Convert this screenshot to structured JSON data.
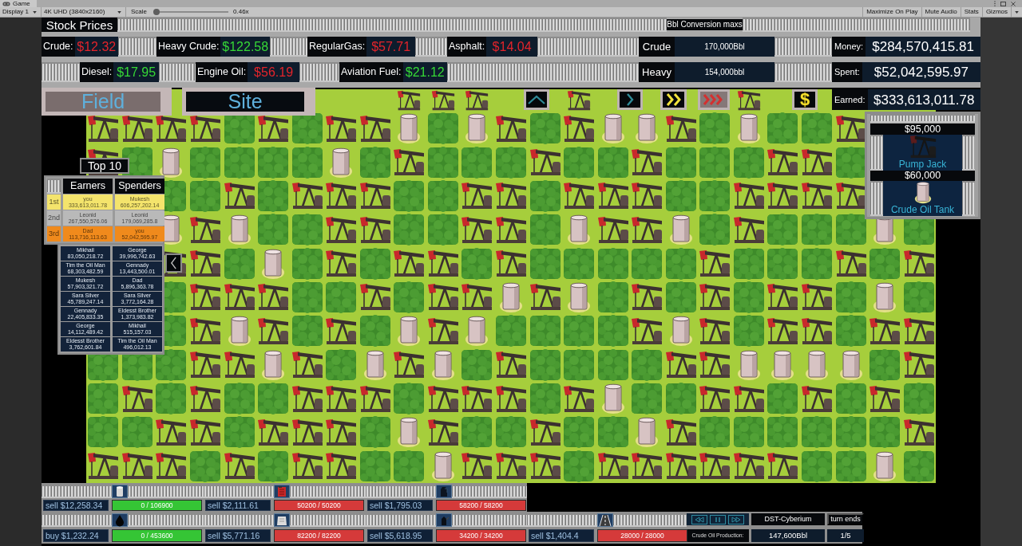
{
  "editor": {
    "tab": "Game",
    "display": "Display 1",
    "resolution": "4K UHD (3840x2160)",
    "scale_label": "Scale",
    "scale": {
      "level": 0
    },
    "scale_value": "0.46x",
    "buttons": [
      "Maximize On Play",
      "Mute Audio",
      "Stats",
      "Gizmos"
    ]
  },
  "stock_prices": {
    "title": "Stock Prices",
    "items": [
      {
        "label": "Crude:",
        "price": "$12.32",
        "rising": false
      },
      {
        "label": "Heavy Crude:",
        "price": "$122.58",
        "rising": true
      },
      {
        "label": "RegularGas:",
        "price": "$57.71",
        "rising": false
      },
      {
        "label": "Asphalt:",
        "price": "$14.04",
        "rising": false
      },
      {
        "label": "Diesel:",
        "price": "$17.95",
        "rising": true
      },
      {
        "label": "Engine Oil:",
        "price": "$56.19",
        "rising": false
      },
      {
        "label": "Aviation Fuel:",
        "price": "$21.12",
        "rising": true
      }
    ]
  },
  "conversion": {
    "title": "Bbl Conversion maxs",
    "items": [
      {
        "label": "Crude",
        "value": "170,000Bbl"
      },
      {
        "label": "Heavy",
        "value": "154,000bbl"
      }
    ]
  },
  "finances": [
    {
      "label": "Money:",
      "value": "$284,570,415.81"
    },
    {
      "label": "Spent:",
      "value": "$52,042,595.97"
    },
    {
      "label": "Earned:",
      "value": "$333,613,011.78"
    }
  ],
  "views": [
    {
      "label": "Field",
      "selected": true
    },
    {
      "label": "Site",
      "selected": false
    }
  ],
  "control_buttons": [
    {
      "kind": "up",
      "selected": false
    },
    {
      "kind": "play",
      "selected": false
    },
    {
      "kind": "fast",
      "selected": false
    },
    {
      "kind": "faster",
      "selected": true
    },
    {
      "kind": "money",
      "label": "$",
      "selected": false
    }
  ],
  "map": {
    "rows": [
      [
        null,
        null,
        null,
        null,
        null,
        null,
        null,
        null,
        null,
        {
          "kind": "jack"
        },
        {
          "kind": "jack"
        },
        {
          "kind": "jack"
        },
        null,
        null,
        {
          "kind": "jack"
        },
        null,
        null,
        null,
        null,
        {
          "kind": "jack"
        },
        null,
        null,
        null,
        null,
        null
      ],
      [
        {
          "kind": "jack"
        },
        {
          "kind": "jack"
        },
        {
          "kind": "jack"
        },
        {
          "kind": "jack"
        },
        {
          "kind": "bush"
        },
        {
          "kind": "jack"
        },
        {
          "kind": "bush"
        },
        {
          "kind": "jack"
        },
        {
          "kind": "jack"
        },
        {
          "kind": "tank"
        },
        {
          "kind": "bush"
        },
        {
          "kind": "tank"
        },
        {
          "kind": "jack"
        },
        {
          "kind": "bush"
        },
        {
          "kind": "jack"
        },
        {
          "kind": "tank"
        },
        {
          "kind": "tank"
        },
        {
          "kind": "jack"
        },
        {
          "kind": "bush"
        },
        {
          "kind": "tank"
        },
        {
          "kind": "bush"
        },
        {
          "kind": "bush"
        },
        {
          "kind": "jack"
        },
        null,
        null
      ],
      [
        {
          "kind": "jack"
        },
        {
          "kind": "bush"
        },
        {
          "kind": "tank"
        },
        {
          "kind": "bush"
        },
        {
          "kind": "bush"
        },
        {
          "kind": "bush"
        },
        {
          "kind": "bush"
        },
        {
          "kind": "tank"
        },
        {
          "kind": "bush"
        },
        {
          "kind": "jack"
        },
        {
          "kind": "bush"
        },
        {
          "kind": "bush"
        },
        {
          "kind": "bush"
        },
        {
          "kind": "jack"
        },
        {
          "kind": "bush"
        },
        {
          "kind": "bush"
        },
        {
          "kind": "jack"
        },
        {
          "kind": "bush"
        },
        {
          "kind": "bush"
        },
        {
          "kind": "bush"
        },
        {
          "kind": "jack"
        },
        {
          "kind": "jack"
        },
        {
          "kind": "bush"
        },
        null,
        null
      ],
      [
        null,
        null,
        {
          "kind": "bush"
        },
        {
          "kind": "bush"
        },
        {
          "kind": "jack"
        },
        {
          "kind": "bush"
        },
        {
          "kind": "jack"
        },
        {
          "kind": "jack"
        },
        {
          "kind": "jack"
        },
        {
          "kind": "bush"
        },
        {
          "kind": "bush"
        },
        {
          "kind": "jack"
        },
        {
          "kind": "jack"
        },
        {
          "kind": "bush"
        },
        {
          "kind": "jack"
        },
        {
          "kind": "jack"
        },
        {
          "kind": "jack"
        },
        {
          "kind": "bush"
        },
        {
          "kind": "bush"
        },
        {
          "kind": "jack"
        },
        {
          "kind": "jack"
        },
        {
          "kind": "jack"
        },
        {
          "kind": "jack"
        },
        null,
        null
      ],
      [
        null,
        null,
        {
          "kind": "tank"
        },
        {
          "kind": "jack"
        },
        {
          "kind": "tank"
        },
        {
          "kind": "bush"
        },
        {
          "kind": "bush"
        },
        {
          "kind": "jack"
        },
        {
          "kind": "jack"
        },
        {
          "kind": "bush"
        },
        {
          "kind": "bush"
        },
        {
          "kind": "jack"
        },
        {
          "kind": "jack"
        },
        {
          "kind": "bush"
        },
        {
          "kind": "tank"
        },
        {
          "kind": "jack"
        },
        {
          "kind": "jack"
        },
        {
          "kind": "tank"
        },
        {
          "kind": "bush"
        },
        {
          "kind": "jack"
        },
        {
          "kind": "bush"
        },
        {
          "kind": "bush"
        },
        {
          "kind": "bush"
        },
        {
          "kind": "tank"
        },
        {
          "kind": "bush"
        }
      ],
      [
        null,
        null,
        {
          "kind": "jack"
        },
        {
          "kind": "jack"
        },
        {
          "kind": "bush"
        },
        {
          "kind": "tank"
        },
        {
          "kind": "bush"
        },
        {
          "kind": "jack"
        },
        {
          "kind": "bush"
        },
        {
          "kind": "jack"
        },
        {
          "kind": "jack"
        },
        {
          "kind": "bush"
        },
        {
          "kind": "jack"
        },
        {
          "kind": "bush"
        },
        {
          "kind": "bush"
        },
        {
          "kind": "bush"
        },
        {
          "kind": "bush"
        },
        {
          "kind": "bush"
        },
        {
          "kind": "jack"
        },
        {
          "kind": "bush"
        },
        {
          "kind": "bush"
        },
        {
          "kind": "bush"
        },
        {
          "kind": "jack"
        },
        {
          "kind": "bush"
        },
        {
          "kind": "jack"
        }
      ],
      [
        null,
        null,
        {
          "kind": "bush"
        },
        {
          "kind": "jack"
        },
        {
          "kind": "jack"
        },
        {
          "kind": "jack"
        },
        {
          "kind": "bush"
        },
        {
          "kind": "bush"
        },
        {
          "kind": "jack"
        },
        {
          "kind": "bush"
        },
        {
          "kind": "jack"
        },
        {
          "kind": "jack"
        },
        {
          "kind": "tank"
        },
        {
          "kind": "jack"
        },
        {
          "kind": "tank"
        },
        {
          "kind": "bush"
        },
        {
          "kind": "jack"
        },
        {
          "kind": "bush"
        },
        {
          "kind": "jack"
        },
        {
          "kind": "bush"
        },
        {
          "kind": "jack"
        },
        {
          "kind": "jack"
        },
        {
          "kind": "bush"
        },
        {
          "kind": "tank"
        },
        {
          "kind": "bush"
        }
      ],
      [
        null,
        null,
        {
          "kind": "bush"
        },
        {
          "kind": "jack"
        },
        {
          "kind": "tank"
        },
        {
          "kind": "jack"
        },
        {
          "kind": "bush"
        },
        {
          "kind": "jack"
        },
        {
          "kind": "bush"
        },
        {
          "kind": "tank"
        },
        {
          "kind": "jack"
        },
        {
          "kind": "tank"
        },
        {
          "kind": "bush"
        },
        {
          "kind": "bush"
        },
        {
          "kind": "bush"
        },
        {
          "kind": "bush"
        },
        {
          "kind": "jack"
        },
        {
          "kind": "tank"
        },
        {
          "kind": "jack"
        },
        {
          "kind": "bush"
        },
        {
          "kind": "jack"
        },
        {
          "kind": "jack"
        },
        {
          "kind": "bush"
        },
        {
          "kind": "jack"
        },
        {
          "kind": "jack"
        }
      ],
      [
        {
          "kind": "bush"
        },
        {
          "kind": "bush"
        },
        {
          "kind": "bush"
        },
        {
          "kind": "jack"
        },
        {
          "kind": "jack"
        },
        {
          "kind": "tank"
        },
        {
          "kind": "jack"
        },
        {
          "kind": "bush"
        },
        {
          "kind": "tank"
        },
        {
          "kind": "jack"
        },
        {
          "kind": "tank"
        },
        {
          "kind": "bush"
        },
        {
          "kind": "jack"
        },
        {
          "kind": "bush"
        },
        {
          "kind": "bush"
        },
        {
          "kind": "bush"
        },
        {
          "kind": "bush"
        },
        {
          "kind": "jack"
        },
        {
          "kind": "jack"
        },
        {
          "kind": "tank"
        },
        {
          "kind": "tank"
        },
        {
          "kind": "tank"
        },
        {
          "kind": "tank"
        },
        {
          "kind": "bush"
        },
        {
          "kind": "jack"
        }
      ],
      [
        {
          "kind": "bush"
        },
        {
          "kind": "jack"
        },
        {
          "kind": "bush"
        },
        {
          "kind": "jack"
        },
        {
          "kind": "bush"
        },
        {
          "kind": "bush"
        },
        {
          "kind": "jack"
        },
        {
          "kind": "jack"
        },
        {
          "kind": "jack"
        },
        {
          "kind": "bush"
        },
        {
          "kind": "jack"
        },
        {
          "kind": "jack"
        },
        {
          "kind": "jack"
        },
        {
          "kind": "bush"
        },
        {
          "kind": "jack"
        },
        {
          "kind": "tank"
        },
        {
          "kind": "bush"
        },
        {
          "kind": "bush"
        },
        {
          "kind": "jack"
        },
        {
          "kind": "jack"
        },
        {
          "kind": "bush"
        },
        {
          "kind": "jack"
        },
        {
          "kind": "bush"
        },
        {
          "kind": "jack"
        },
        {
          "kind": "bush"
        }
      ],
      [
        {
          "kind": "bush"
        },
        {
          "kind": "bush"
        },
        {
          "kind": "jack"
        },
        {
          "kind": "jack"
        },
        {
          "kind": "bush"
        },
        {
          "kind": "jack"
        },
        {
          "kind": "jack"
        },
        {
          "kind": "jack"
        },
        {
          "kind": "bush"
        },
        {
          "kind": "tank"
        },
        {
          "kind": "jack"
        },
        {
          "kind": "bush"
        },
        {
          "kind": "bush"
        },
        {
          "kind": "jack"
        },
        {
          "kind": "bush"
        },
        {
          "kind": "bush"
        },
        {
          "kind": "tank"
        },
        {
          "kind": "jack"
        },
        {
          "kind": "bush"
        },
        {
          "kind": "bush"
        },
        {
          "kind": "bush"
        },
        {
          "kind": "bush"
        },
        {
          "kind": "bush"
        },
        {
          "kind": "bush"
        },
        {
          "kind": "jack"
        }
      ],
      [
        {
          "kind": "jack"
        },
        {
          "kind": "jack"
        },
        {
          "kind": "jack"
        },
        {
          "kind": "bush"
        },
        {
          "kind": "jack"
        },
        {
          "kind": "bush"
        },
        {
          "kind": "jack"
        },
        {
          "kind": "jack"
        },
        {
          "kind": "bush"
        },
        {
          "kind": "bush"
        },
        {
          "kind": "tank"
        },
        {
          "kind": "jack"
        },
        {
          "kind": "jack"
        },
        {
          "kind": "jack"
        },
        {
          "kind": "bush"
        },
        {
          "kind": "jack"
        },
        {
          "kind": "jack"
        },
        {
          "kind": "jack"
        },
        {
          "kind": "jack"
        },
        {
          "kind": "jack"
        },
        {
          "kind": "jack"
        },
        {
          "kind": "bush"
        },
        {
          "kind": "bush"
        },
        {
          "kind": "tank"
        },
        {
          "kind": "bush"
        }
      ]
    ]
  },
  "leaderboard": {
    "title": "Top 10",
    "columns": [
      "Earners",
      "Spenders"
    ],
    "rows": [
      {
        "rank": "1st",
        "color": "#f4e46c",
        "earner": {
          "name": "you",
          "amount": "333,613,011.78"
        },
        "spender": {
          "name": "Mukesh",
          "amount": "606,257,202.14"
        }
      },
      {
        "rank": "2nd",
        "color": "#b9b9b9",
        "earner": {
          "name": "Leonid",
          "amount": "267,550,576.06"
        },
        "spender": {
          "name": "Leonid",
          "amount": "179,069,285.8"
        }
      },
      {
        "rank": "3rd",
        "color": "#f08a1c",
        "earner": {
          "name": "Dad",
          "amount": "113,716,113.63"
        },
        "spender": {
          "name": "you",
          "amount": "52,042,595.97"
        }
      },
      {
        "color": "#13233a",
        "earner": {
          "name": "Mikhail",
          "amount": "83,050,218.72"
        },
        "spender": {
          "name": "George",
          "amount": "39,996,742.63"
        }
      },
      {
        "color": "#13233a",
        "earner": {
          "name": "Tim the Oil Man",
          "amount": "68,303,482.59"
        },
        "spender": {
          "name": "Gennady",
          "amount": "13,443,500.01"
        }
      },
      {
        "color": "#13233a",
        "earner": {
          "name": "Mukesh",
          "amount": "57,903,321.72"
        },
        "spender": {
          "name": "Dad",
          "amount": "5,896,363.78"
        }
      },
      {
        "color": "#13233a",
        "earner": {
          "name": "Sara Silver",
          "amount": "45,789,247.14"
        },
        "spender": {
          "name": "Sara Silver",
          "amount": "3,772,164.28"
        }
      },
      {
        "color": "#13233a",
        "earner": {
          "name": "Gennady",
          "amount": "22,405,833.35"
        },
        "spender": {
          "name": "Eldesst Brother",
          "amount": "1,373,983.82"
        }
      },
      {
        "color": "#13233a",
        "earner": {
          "name": "George",
          "amount": "14,112,489.42"
        },
        "spender": {
          "name": "Mikhail",
          "amount": "515,157.03"
        }
      },
      {
        "color": "#13233a",
        "earner": {
          "name": "Eldesst Brother",
          "amount": "3,762,601.84"
        },
        "spender": {
          "name": "Tim the Oil Man",
          "amount": "496,012.13"
        }
      }
    ]
  },
  "shop": [
    {
      "kind": "jack",
      "price": "$95,000",
      "name": "Pump Jack"
    },
    {
      "kind": "tank",
      "price": "$60,000",
      "name": "Crude Oil Tank"
    }
  ],
  "resources": [
    {
      "kind": "tank",
      "trade": "sell $12,258.34",
      "stock": "0 / 106900",
      "level": 0
    },
    {
      "kind": "canister",
      "trade": "sell $2,111.61",
      "stock": "50200 / 50200",
      "level": 1
    },
    {
      "kind": "jug",
      "trade": "sell $1,795.03",
      "stock": "58200 / 58200",
      "level": 1
    },
    {
      "kind": "drop",
      "trade": "buy $1,232.24",
      "stock": "0 / 453600",
      "level": 0
    },
    {
      "kind": "sack",
      "trade": "sell $5,771.16",
      "stock": "82200 / 82200",
      "level": 1
    },
    {
      "kind": "can",
      "trade": "sell $5,618.95",
      "stock": "34200 / 34200",
      "level": 1
    },
    {
      "kind": "road",
      "trade": "sell $1,404.4",
      "stock": "28000 / 28000",
      "level": 1
    }
  ],
  "status": {
    "location": "DST-Cyberium",
    "turn_label": "turn ends",
    "production_label": "Crude Oil Production:",
    "production": "147,600Bbl",
    "turn": "1/5"
  }
}
